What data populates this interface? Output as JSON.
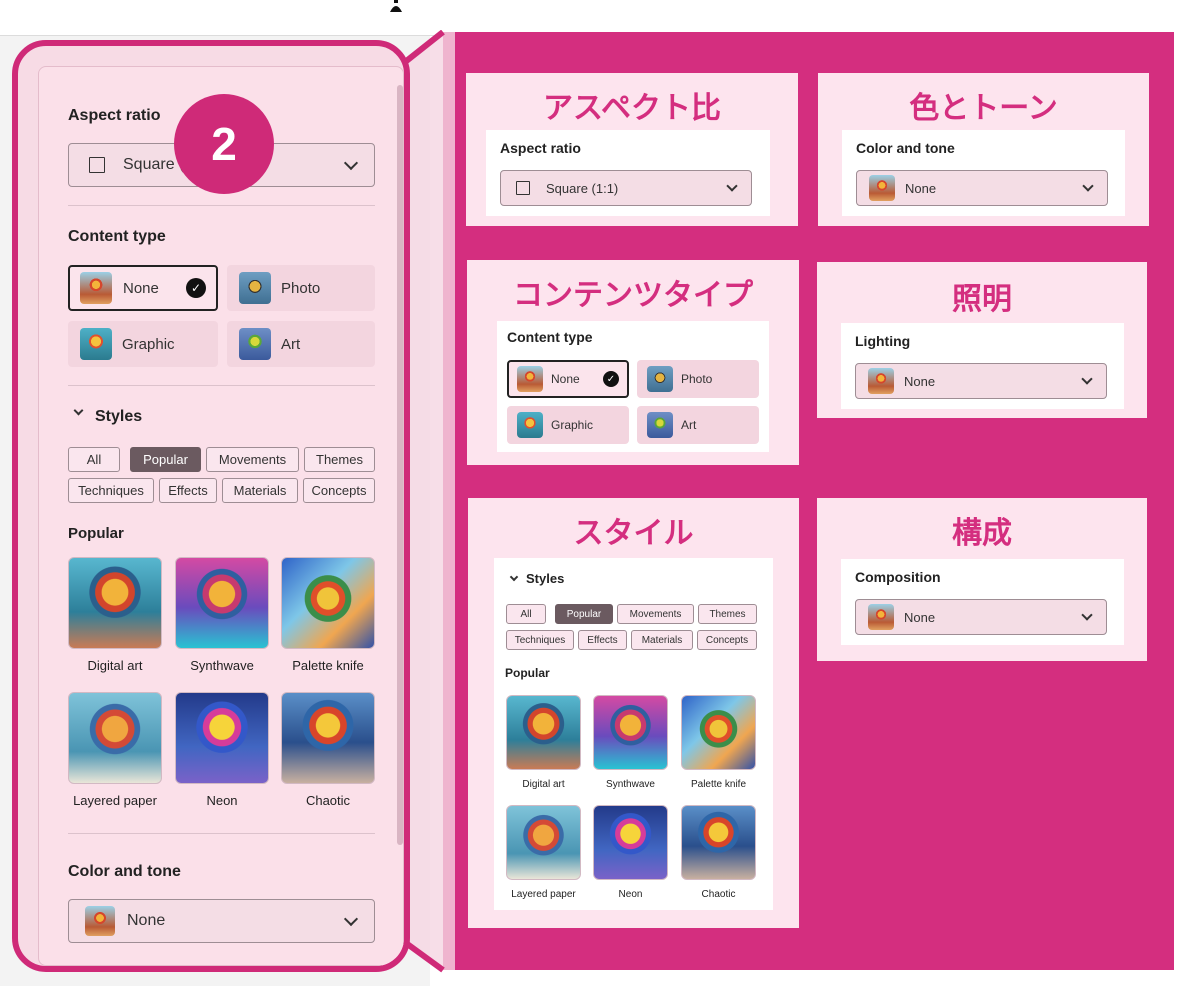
{
  "left_panel": {
    "badge": "2",
    "aspect_ratio": {
      "label": "Aspect ratio",
      "value": "Square ("
    },
    "content_type": {
      "label": "Content type",
      "options": [
        {
          "label": "None",
          "selected": true
        },
        {
          "label": "Photo",
          "selected": false
        },
        {
          "label": "Graphic",
          "selected": false
        },
        {
          "label": "Art",
          "selected": false
        }
      ]
    },
    "styles": {
      "label": "Styles",
      "chips": [
        "All",
        "Popular",
        "Movements",
        "Themes",
        "Techniques",
        "Effects",
        "Materials",
        "Concepts"
      ],
      "active_chip": "Popular",
      "section": "Popular",
      "thumbs": [
        "Digital art",
        "Synthwave",
        "Palette knife",
        "Layered paper",
        "Neon",
        "Chaotic"
      ]
    },
    "color_tone": {
      "label": "Color and tone",
      "value": "None"
    }
  },
  "cards": {
    "aspect": {
      "title": "アスペクト比",
      "label": "Aspect ratio",
      "value": "Square (1:1)"
    },
    "color": {
      "title": "色とトーン",
      "label": "Color and tone",
      "value": "None"
    },
    "content": {
      "title": "コンテンツタイプ",
      "label": "Content type",
      "options": [
        "None",
        "Photo",
        "Graphic",
        "Art"
      ]
    },
    "lighting": {
      "title": "照明",
      "label": "Lighting",
      "value": "None"
    },
    "styles": {
      "title": "スタイル",
      "label": "Styles",
      "chips": [
        "All",
        "Popular",
        "Movements",
        "Themes",
        "Techniques",
        "Effects",
        "Materials",
        "Concepts"
      ],
      "section": "Popular",
      "thumbs": [
        "Digital art",
        "Synthwave",
        "Palette knife",
        "Layered paper",
        "Neon",
        "Chaotic"
      ]
    },
    "composition": {
      "title": "構成",
      "label": "Composition",
      "value": "None"
    }
  },
  "icons": [
    "person-icon",
    "checkbox-square-icon",
    "chevron-down-icon",
    "check-circle-icon",
    "chevron-collapse-icon",
    "balloon-thumbnail-icon"
  ],
  "colors": {
    "accent": "#d42e7f",
    "card": "#fde4ee",
    "panel": "#fbe0e9",
    "active_chip": "#6b5a60"
  }
}
